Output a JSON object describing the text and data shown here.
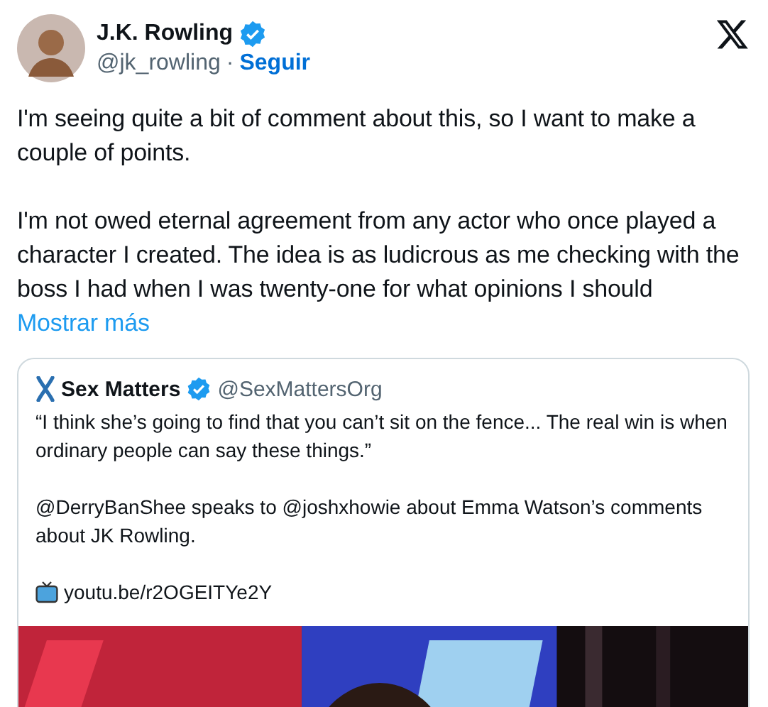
{
  "author": {
    "name": "J.K. Rowling",
    "verified": true,
    "handle": "@jk_rowling",
    "separator": "·",
    "follow": "Seguir"
  },
  "paragraphs": [
    "I'm seeing quite a bit of comment about this, so I want to make a couple of points.",
    "I'm not owed eternal agreement from any actor who once played a character I created. The idea is as ludicrous as me checking with the boss I had when I was twenty-one for what opinions I should"
  ],
  "show_more": "Mostrar más",
  "quoted": {
    "name": "Sex Matters",
    "verified": true,
    "handle": "@SexMattersOrg",
    "paragraphs": [
      "“I think she’s going to find that you can’t sit on the fence... The real win is when ordinary people can say these things.”",
      "@DerryBanShee speaks to @joshxhowie about Emma Watson’s comments about JK Rowling."
    ],
    "link": "youtu.be/r2OGEITYe2Y"
  }
}
